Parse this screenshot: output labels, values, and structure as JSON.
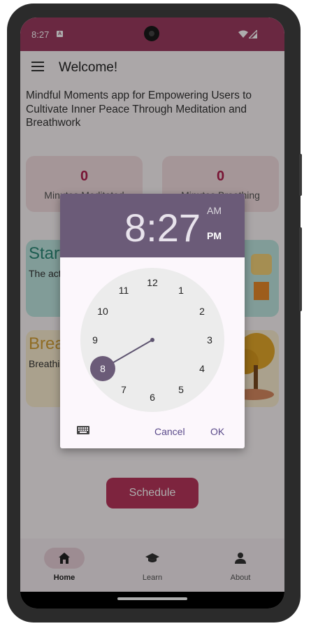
{
  "status_bar": {
    "time": "8:27",
    "notif_label": "A"
  },
  "app_bar": {
    "title": "Welcome!"
  },
  "intro_text": "Mindful Moments app for Empowering Users to Cultivate Inner Peace Through Meditation and Breathwork",
  "stats": [
    {
      "value": "0",
      "label": "Minutes Meditated"
    },
    {
      "value": "0",
      "label": "Minutes Breathing"
    }
  ],
  "cards": [
    {
      "title": "Start",
      "text": "The act of being s",
      "bg": "#bfe6e0",
      "title_color": "#2c8a78"
    },
    {
      "title": "Breat",
      "text": "Breathi pleasur",
      "bg": "#fbeed0",
      "title_color": "#d4a035"
    }
  ],
  "schedule_button": "Schedule",
  "nav": [
    {
      "label": "Home",
      "icon": "home-icon",
      "active": true
    },
    {
      "label": "Learn",
      "icon": "school-icon",
      "active": false
    },
    {
      "label": "About",
      "icon": "person-icon",
      "active": false
    }
  ],
  "time_picker": {
    "hour": "8",
    "separator": ":",
    "minute": "27",
    "am_label": "AM",
    "pm_label": "PM",
    "selected_period": "PM",
    "dial_numbers": [
      "12",
      "1",
      "2",
      "3",
      "4",
      "5",
      "6",
      "7",
      "8",
      "9",
      "10",
      "11"
    ],
    "selected_hour": "8",
    "cancel_label": "Cancel",
    "ok_label": "OK",
    "keyboard_icon": "keyboard-icon"
  },
  "colors": {
    "status_bar": "#9d3b60",
    "accent": "#b8355c",
    "dialog_header": "#6b5b78",
    "dial_face": "#ececec",
    "dial_hand": "#5e5470"
  }
}
